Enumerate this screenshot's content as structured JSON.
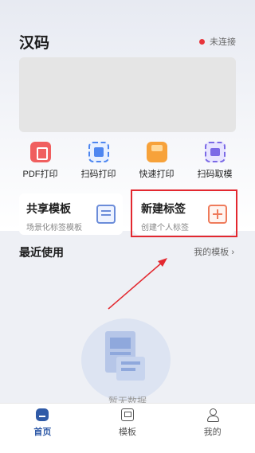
{
  "header": {
    "title": "汉码",
    "connection_status": "未连接",
    "status_color": "#e8343b"
  },
  "quick_actions": [
    {
      "label": "PDF打印",
      "icon": "pdf-icon"
    },
    {
      "label": "扫码打印",
      "icon": "scan-print-icon"
    },
    {
      "label": "快速打印",
      "icon": "printer-icon"
    },
    {
      "label": "扫码取模",
      "icon": "scan-template-icon"
    }
  ],
  "cards": {
    "share": {
      "title": "共享模板",
      "subtitle": "场景化标签模板",
      "icon": "template-share-icon"
    },
    "new_label": {
      "title": "新建标签",
      "subtitle": "创建个人标签",
      "icon": "add-label-icon"
    }
  },
  "recent": {
    "title": "最近使用",
    "my_templates_link": "我的模板",
    "empty_text": "暂无数据"
  },
  "tabbar": [
    {
      "label": "首页",
      "icon": "home-icon",
      "active": true
    },
    {
      "label": "模板",
      "icon": "template-icon",
      "active": false
    },
    {
      "label": "我的",
      "icon": "profile-icon",
      "active": false
    }
  ],
  "colors": {
    "accent": "#2f5aa7",
    "highlight": "#e3282f"
  }
}
